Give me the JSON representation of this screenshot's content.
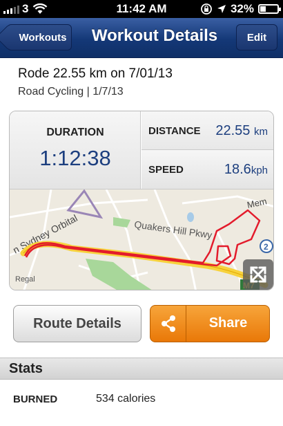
{
  "status_bar": {
    "carrier": "3",
    "time": "11:42 AM",
    "battery": "32%"
  },
  "nav": {
    "back_label": "Workouts",
    "title": "Workout Details",
    "edit_label": "Edit"
  },
  "workout": {
    "title": "Rode 22.55 km on 7/01/13",
    "subtitle": "Road Cycling | 1/7/13"
  },
  "summary": {
    "duration_label": "DURATION",
    "duration_value": "1:12:38",
    "distance_label": "DISTANCE",
    "distance_value": "22.55",
    "distance_unit": "km",
    "speed_label": "SPEED",
    "speed_value": "18.6",
    "speed_unit": "kph"
  },
  "map": {
    "labels": {
      "quakers": "Quakers Hill Pkwy",
      "orbital": "n Sydney Orbital",
      "mem": "Mem",
      "regal": "Regal",
      "route_num": "2",
      "motorway": "M7"
    },
    "colors": {
      "route": "#e31b2c",
      "highway": "#f7d23d",
      "park": "#a8d79a"
    }
  },
  "actions": {
    "route_details_label": "Route Details",
    "share_label": "Share"
  },
  "stats": {
    "title": "Stats",
    "rows": [
      {
        "label": "BURNED",
        "value": "534 calories"
      }
    ]
  },
  "icons": [
    "wifi-icon",
    "lock-rotation-icon",
    "location-arrow-icon",
    "battery-icon",
    "expand-icon",
    "share-icon"
  ]
}
